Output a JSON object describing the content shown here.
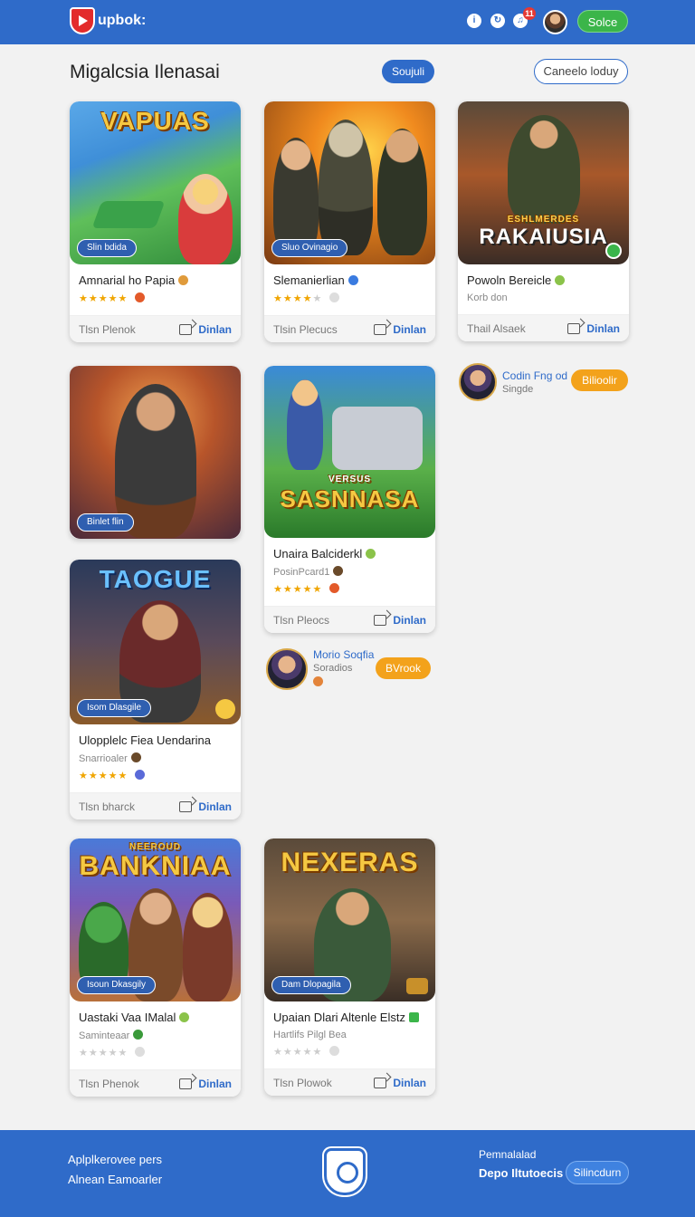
{
  "header": {
    "logo_text": "upbok:",
    "icons": [
      "info-icon",
      "refresh-icon",
      "notification-icon"
    ],
    "notification_count": "11",
    "action_button": "Solce"
  },
  "page": {
    "title": "Migalcsia Ilenasai",
    "primary_pill": "Soujuli",
    "secondary_pill": "Caneelo loduy"
  },
  "cards": [
    {
      "art_title": "VAPUAS",
      "chip": "Slin bdida",
      "title": "Amnarial ho Papia",
      "rating": 5,
      "footer_left": "Tlsn Plenok",
      "footer_action": "Dinlan"
    },
    {
      "art_title": "",
      "chip": "Sluo Ovinagio",
      "title": "Slemanierlian",
      "rating": 4,
      "footer_left": "Tlsin Plecucs",
      "footer_action": "Dinlan"
    },
    {
      "art_title": "RAKAIUSIA",
      "art_subtitle": "ESHLMERDES",
      "chip": "",
      "title": "Powoln Bereicle",
      "subtitle": "Korb don",
      "rating": 0,
      "footer_left": "Thail Alsaek",
      "footer_action": "Dinlan"
    },
    {
      "art_title": "",
      "chip": "Binlet flin",
      "title": "",
      "rating": 0,
      "footer_left": "",
      "footer_action": ""
    },
    {
      "art_title": "SASNNASA",
      "art_subtitle": "VERSUS",
      "chip": "",
      "title": "Unaira Balciderkl",
      "subtitle": "PosinPcard1",
      "rating": 5,
      "footer_left": "Tlsn Pleocs",
      "footer_action": "Dinlan"
    },
    {
      "art_title": "TAOGUE",
      "chip": "Isom Dlasgile",
      "title": "Ulopplelc Fiea Uendarina",
      "subtitle": "Snarrioaler",
      "rating": 5,
      "footer_left": "Tlsn bharck",
      "footer_action": "Dinlan"
    },
    {
      "art_title": "BANKNIAA",
      "art_subtitle": "NEEROUD",
      "chip": "Isoun Dkasgily",
      "title": "Uastaki Vaa IMalal",
      "subtitle": "Saminteaar",
      "rating": 0,
      "footer_left": "Tlsn Phenok",
      "footer_action": "Dinlan"
    },
    {
      "art_title": "NEXERAS",
      "chip": "Dam Dlopagila",
      "title": "Upaian Dlari Altenle Elstz",
      "subtitle": "Hartlifs Pilgl Bea",
      "rating": 0,
      "footer_left": "Tlsn Plowok",
      "footer_action": "Dinlan"
    }
  ],
  "creators": [
    {
      "name": "Codin Fng od",
      "sub": "Singde",
      "button": "Bilioolir"
    },
    {
      "name": "Morio Soqfia",
      "sub": "Soradios",
      "button": "BVrook"
    }
  ],
  "footer": {
    "line1": "Aplplkerovee pers",
    "line2": "Alnean Eamoarler",
    "right_top": "Pemnalalad",
    "right_bold": "Depo Iltutoecis",
    "button": "Silincdurn"
  },
  "colors": {
    "brand_blue": "#2f6bc9",
    "accent_green": "#3bb54a",
    "accent_orange": "#f3a21b",
    "star": "#f0a500"
  }
}
